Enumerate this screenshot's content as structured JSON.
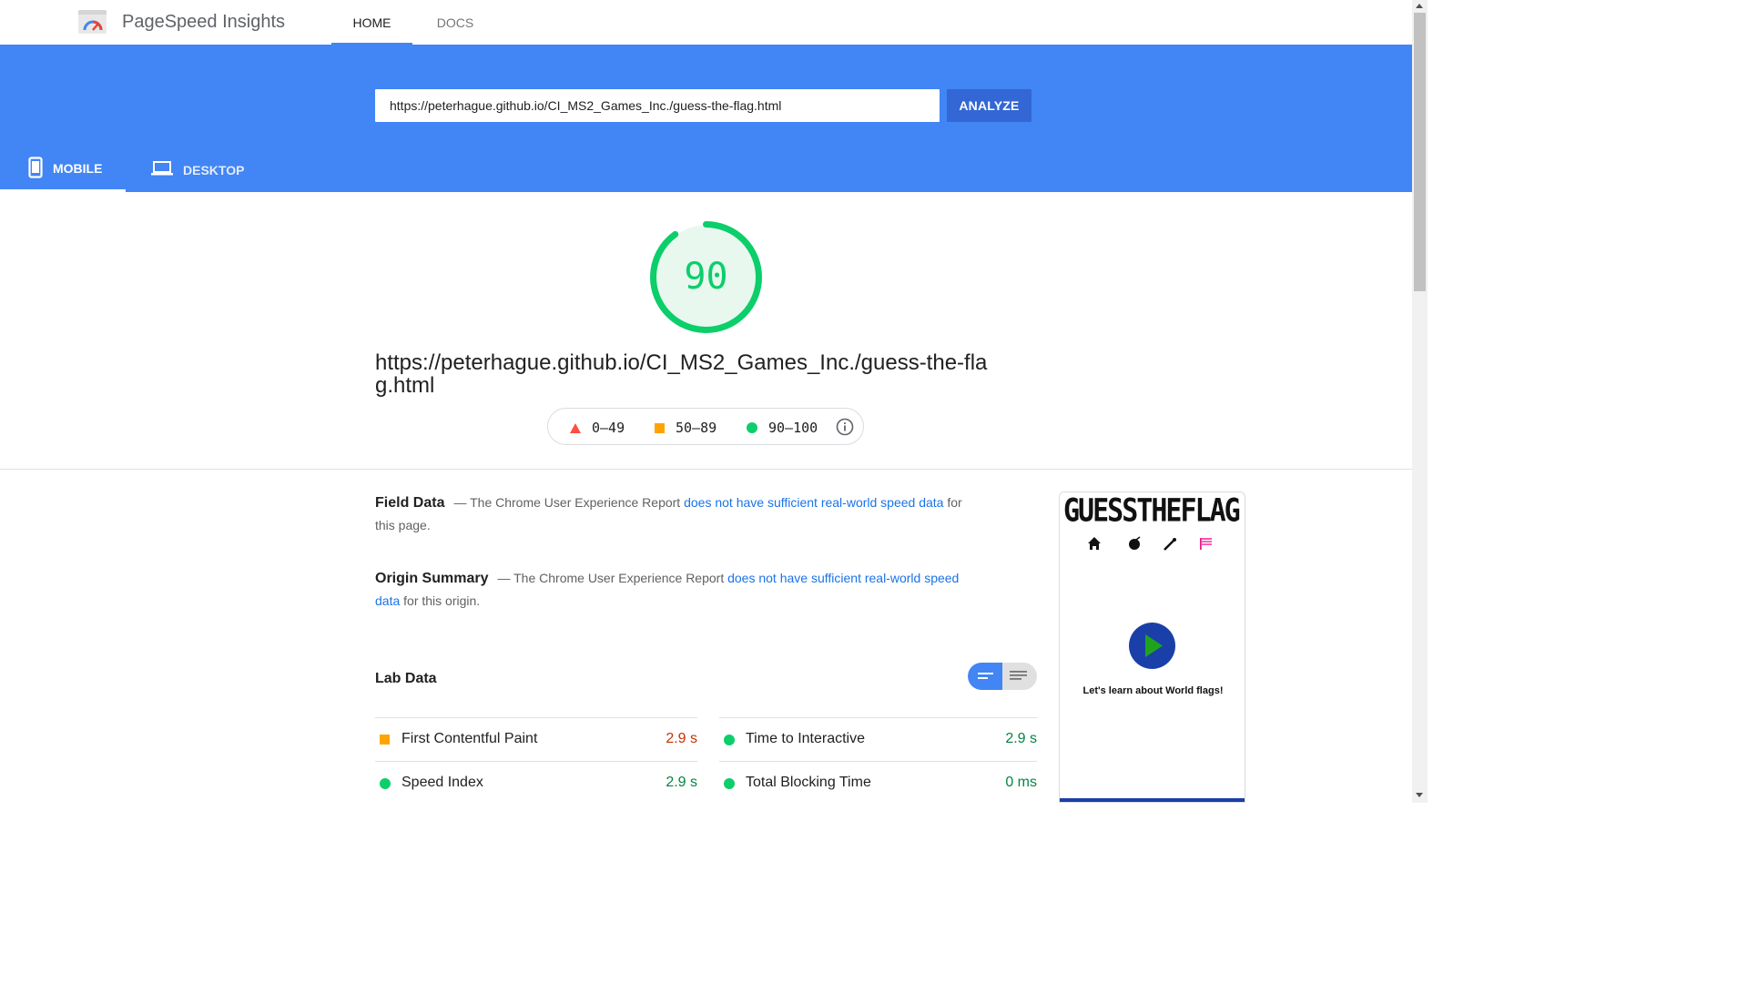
{
  "header": {
    "app_title": "PageSpeed Insights",
    "nav": [
      {
        "label": "HOME",
        "active": true
      },
      {
        "label": "DOCS",
        "active": false
      }
    ]
  },
  "search": {
    "url_value": "https://peterhague.github.io/CI_MS2_Games_Inc./guess-the-flag.html",
    "analyze_label": "ANALYZE"
  },
  "device_tabs": [
    {
      "label": "MOBILE",
      "icon": "phone-icon",
      "active": true
    },
    {
      "label": "DESKTOP",
      "icon": "laptop-icon",
      "active": false
    }
  ],
  "score": {
    "value": "90",
    "fraction": 0.9,
    "color": "#0cce6b",
    "page_url": "https://peterhague.github.io/CI_MS2_Games_Inc./guess-the-flag.html"
  },
  "legend": [
    {
      "range": "0–49",
      "icon": "triangle-icon",
      "color": "#ff4e42"
    },
    {
      "range": "50–89",
      "icon": "square-icon",
      "color": "#ffa400"
    },
    {
      "range": "90–100",
      "icon": "circle-icon",
      "color": "#0cce6b"
    }
  ],
  "field_data": {
    "title": "Field Data",
    "text_before": "— The Chrome User Experience Report ",
    "link": "does not have sufficient real-world speed data",
    "text_after": " for this page."
  },
  "origin_summary": {
    "title": "Origin Summary",
    "text_before": "— The Chrome User Experience Report ",
    "link": "does not have sufficient real-world speed data",
    "text_after": " for this origin."
  },
  "lab_data": {
    "title": "Lab Data",
    "metrics": [
      {
        "label": "First Contentful Paint",
        "value": "2.9 s",
        "status": "average"
      },
      {
        "label": "Time to Interactive",
        "value": "2.9 s",
        "status": "pass"
      },
      {
        "label": "Speed Index",
        "value": "2.9 s",
        "status": "pass"
      },
      {
        "label": "Total Blocking Time",
        "value": "0 ms",
        "status": "pass"
      }
    ]
  },
  "thumbnail": {
    "title": "GUESSTHEFLAG",
    "caption": "Let's learn about World flags!"
  },
  "colors": {
    "brand_blue": "#4285f4",
    "button_blue": "#3367d6",
    "pass": "#0cce6b",
    "average": "#ffa400",
    "fail": "#ff4e42"
  }
}
